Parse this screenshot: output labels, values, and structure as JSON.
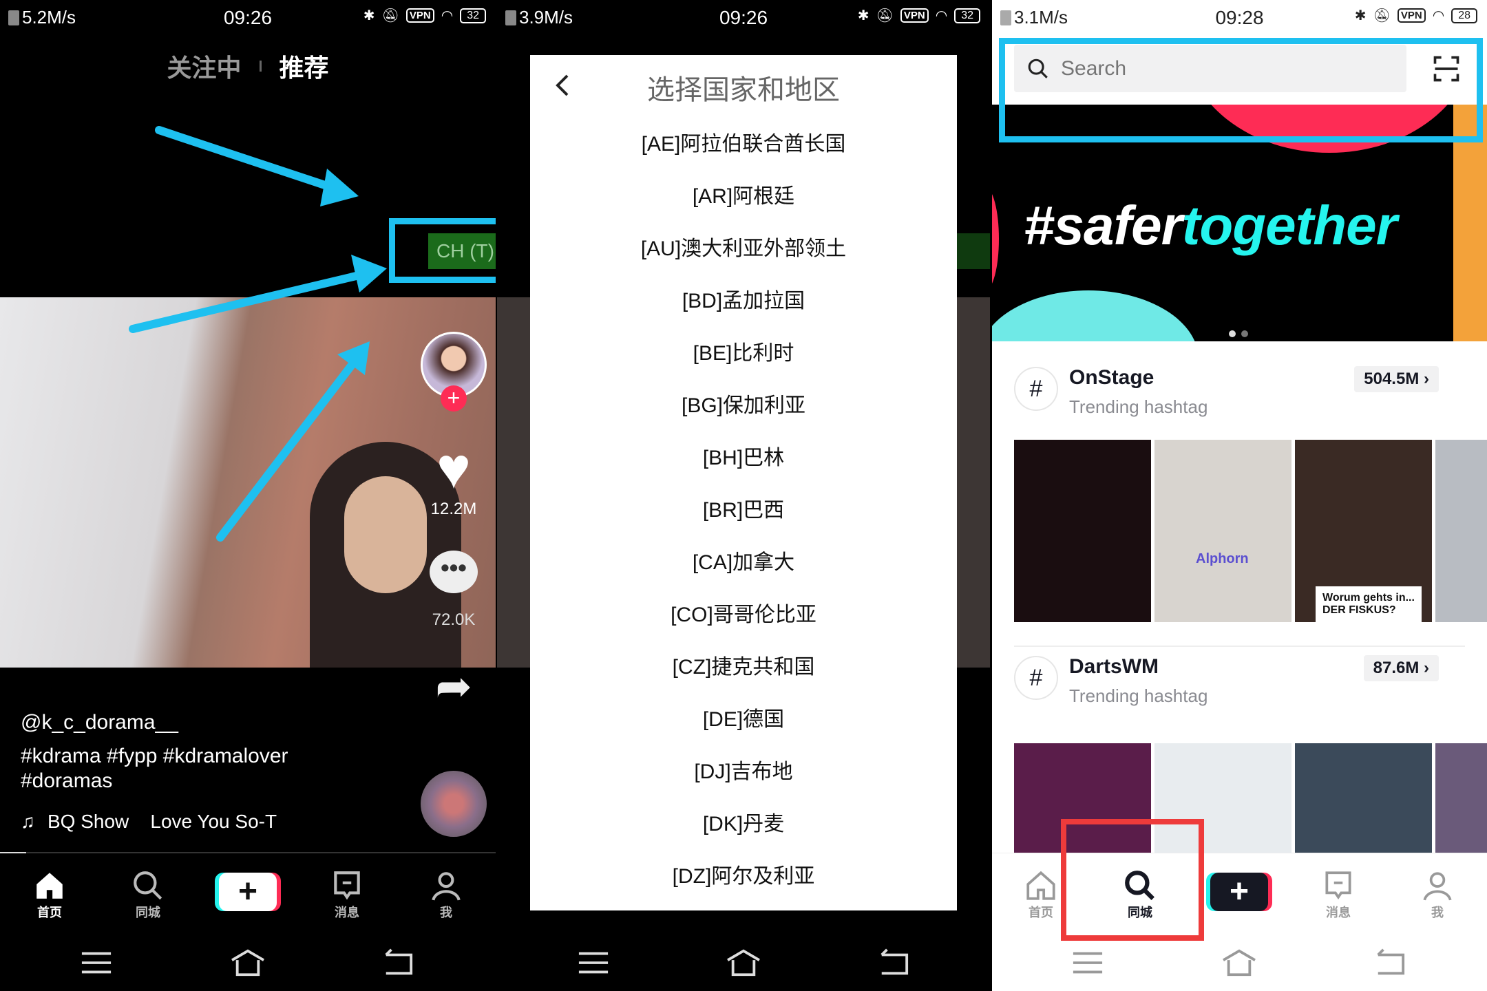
{
  "panel1": {
    "status": {
      "speed": "5.2M/s",
      "time": "09:26",
      "vpn": "VPN",
      "battery": "32"
    },
    "tabs": [
      {
        "label": "关注中"
      },
      {
        "label": "推荐",
        "active": true
      }
    ],
    "region_button": "CH (T)",
    "likes": "12.2M",
    "comments": "72.0K",
    "username": "@k_c_dorama__",
    "caption_line1": "#kdrama #fypp #kdramalover",
    "caption_line2": "#doramas",
    "music": "BQ Show    Love You So-T",
    "nav": [
      {
        "label": "首页",
        "icon": "home-icon"
      },
      {
        "label": "同城",
        "icon": "search-icon"
      },
      {
        "label": "+",
        "icon": "plus-icon"
      },
      {
        "label": "消息",
        "icon": "message-icon"
      },
      {
        "label": "我",
        "icon": "profile-icon"
      }
    ]
  },
  "panel2": {
    "status": {
      "speed": "3.9M/s",
      "time": "09:26",
      "vpn": "VPN",
      "battery": "32"
    },
    "dialog_title": "选择国家和地区",
    "countries": [
      "[AE]阿拉伯联合酋长国",
      "[AR]阿根廷",
      "[AU]澳大利亚外部领土",
      "[BD]孟加拉国",
      "[BE]比利时",
      "[BG]保加利亚",
      "[BH]巴林",
      "[BR]巴西",
      "[CA]加拿大",
      "[CO]哥哥伦比亚",
      "[CZ]捷克共和国",
      "[DE]德国",
      "[DJ]吉布地",
      "[DK]丹麦",
      "[DZ]阿尔及利亚"
    ]
  },
  "panel3": {
    "status": {
      "speed": "3.1M/s",
      "time": "09:28",
      "vpn": "VPN",
      "battery": "28"
    },
    "search_placeholder": "Search",
    "banner": {
      "part1": "#safer",
      "part2": "together"
    },
    "hashtags": [
      {
        "name": "OnStage",
        "subtitle": "Trending hashtag",
        "count": "504.5M",
        "thumb_captions": [
          "",
          "Alphorn",
          "Worum gehts in...\nDER FISKUS?",
          ""
        ]
      },
      {
        "name": "DartsWM",
        "subtitle": "Trending hashtag",
        "count": "87.6M"
      }
    ],
    "nav": [
      {
        "label": "首页"
      },
      {
        "label": "同城",
        "active": true
      },
      {
        "label": "+"
      },
      {
        "label": "消息"
      },
      {
        "label": "我"
      }
    ]
  },
  "colors": {
    "highlight_blue": "#1ec0f0",
    "highlight_red": "#ee3b3b",
    "cyan": "#25f4ee",
    "pink": "#fe2c55",
    "region_green": "#1b6b1b"
  }
}
